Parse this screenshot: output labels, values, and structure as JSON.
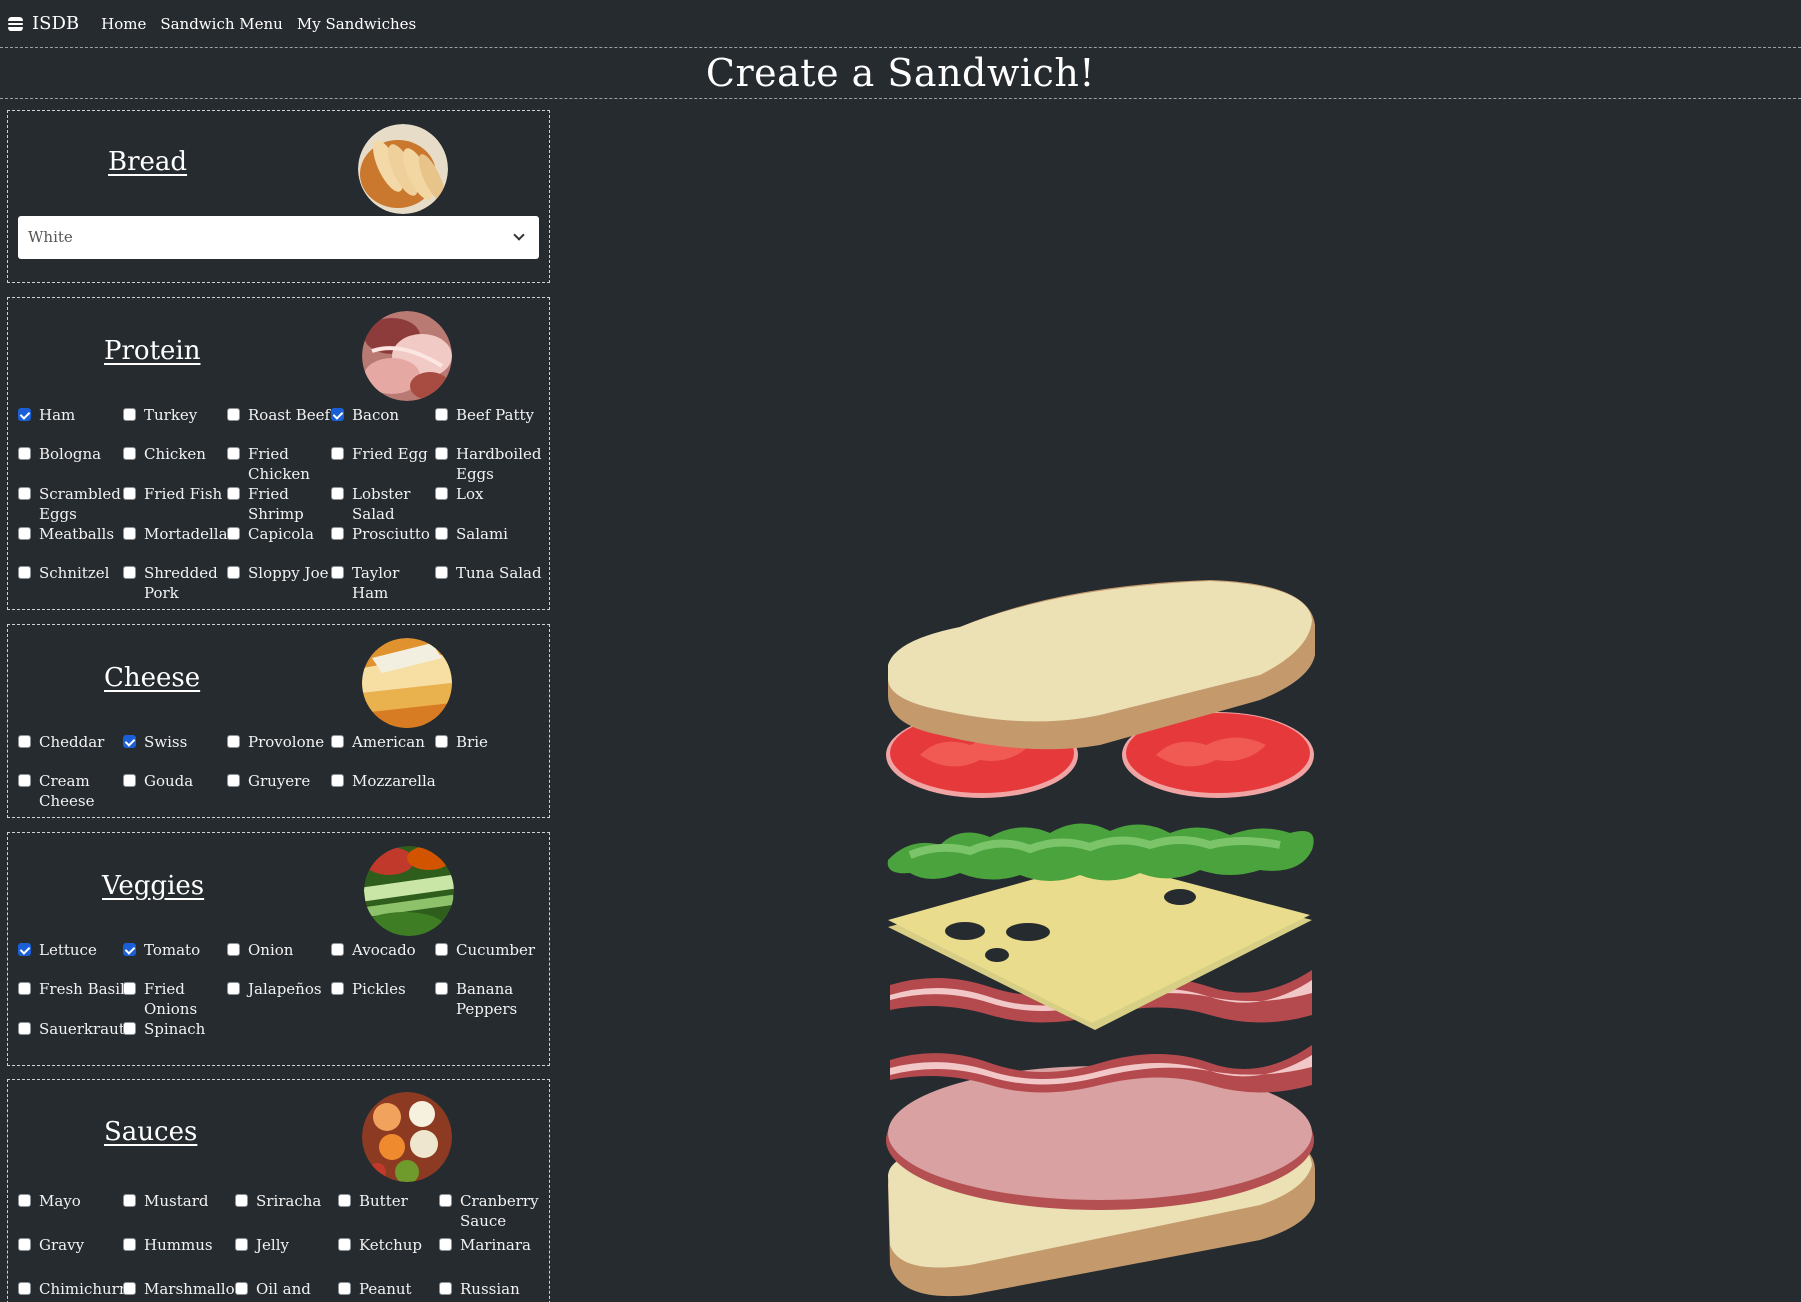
{
  "nav": {
    "brand": "ISDB",
    "brand_icon": "burger-icon",
    "links": [
      "Home",
      "Sandwich Menu",
      "My Sandwiches"
    ]
  },
  "page": {
    "title": "Create a Sandwich!"
  },
  "bread": {
    "title": "Bread",
    "photo": "bread-photo",
    "selected": "White"
  },
  "protein": {
    "title": "Protein",
    "photo": "protein-photo",
    "options": [
      {
        "label": "Ham",
        "checked": true
      },
      {
        "label": "Turkey",
        "checked": false
      },
      {
        "label": "Roast Beef",
        "checked": false
      },
      {
        "label": "Bacon",
        "checked": true
      },
      {
        "label": "Beef Patty",
        "checked": false
      },
      {
        "label": "Bologna",
        "checked": false
      },
      {
        "label": "Chicken",
        "checked": false
      },
      {
        "label": "Fried Chicken",
        "checked": false
      },
      {
        "label": "Fried Egg",
        "checked": false
      },
      {
        "label": "Hardboiled Eggs",
        "checked": false
      },
      {
        "label": "Scrambled Eggs",
        "checked": false
      },
      {
        "label": "Fried Fish",
        "checked": false
      },
      {
        "label": "Fried Shrimp",
        "checked": false
      },
      {
        "label": "Lobster Salad",
        "checked": false
      },
      {
        "label": "Lox",
        "checked": false
      },
      {
        "label": "Meatballs",
        "checked": false
      },
      {
        "label": "Mortadella",
        "checked": false
      },
      {
        "label": "Capicola",
        "checked": false
      },
      {
        "label": "Prosciutto",
        "checked": false
      },
      {
        "label": "Salami",
        "checked": false
      },
      {
        "label": "Schnitzel",
        "checked": false
      },
      {
        "label": "Shredded Pork",
        "checked": false
      },
      {
        "label": "Sloppy Joe",
        "checked": false
      },
      {
        "label": "Taylor Ham",
        "checked": false
      },
      {
        "label": "Tuna Salad",
        "checked": false
      }
    ]
  },
  "cheese": {
    "title": "Cheese",
    "photo": "cheese-photo",
    "options": [
      {
        "label": "Cheddar",
        "checked": false
      },
      {
        "label": "Swiss",
        "checked": true
      },
      {
        "label": "Provolone",
        "checked": false
      },
      {
        "label": "American",
        "checked": false
      },
      {
        "label": "Brie",
        "checked": false
      },
      {
        "label": "Cream Cheese",
        "checked": false
      },
      {
        "label": "Gouda",
        "checked": false
      },
      {
        "label": "Gruyere",
        "checked": false
      },
      {
        "label": "Mozzarella",
        "checked": false
      }
    ]
  },
  "veggies": {
    "title": "Veggies",
    "photo": "veggies-photo",
    "options": [
      {
        "label": "Lettuce",
        "checked": true
      },
      {
        "label": "Tomato",
        "checked": true
      },
      {
        "label": "Onion",
        "checked": false
      },
      {
        "label": "Avocado",
        "checked": false
      },
      {
        "label": "Cucumber",
        "checked": false
      },
      {
        "label": "Fresh Basil",
        "checked": false
      },
      {
        "label": "Fried Onions",
        "checked": false
      },
      {
        "label": "Jalapeños",
        "checked": false
      },
      {
        "label": "Pickles",
        "checked": false
      },
      {
        "label": "Banana Peppers",
        "checked": false
      },
      {
        "label": "Sauerkraut",
        "checked": false
      },
      {
        "label": "Spinach",
        "checked": false
      }
    ]
  },
  "sauces": {
    "title": "Sauces",
    "photo": "sauces-photo",
    "options": [
      {
        "label": "Mayo",
        "checked": false
      },
      {
        "label": "Mustard",
        "checked": false
      },
      {
        "label": "Sriracha",
        "checked": false
      },
      {
        "label": "Butter",
        "checked": false
      },
      {
        "label": "Cranberry Sauce",
        "checked": false
      },
      {
        "label": "Gravy",
        "checked": false
      },
      {
        "label": "Hummus",
        "checked": false
      },
      {
        "label": "Jelly",
        "checked": false
      },
      {
        "label": "Ketchup",
        "checked": false
      },
      {
        "label": "Marinara",
        "checked": false
      },
      {
        "label": "Chimichurri",
        "checked": false
      },
      {
        "label": "Marshmallow",
        "checked": false
      },
      {
        "label": "Oil and",
        "checked": false
      },
      {
        "label": "Peanut Butt",
        "checked": false
      },
      {
        "label": "Russian",
        "checked": false
      }
    ]
  },
  "preview": {
    "layers": [
      "top-bread",
      "tomato",
      "lettuce",
      "swiss-cheese",
      "bacon",
      "ham",
      "bottom-bread"
    ]
  },
  "colors": {
    "background": "#262b30",
    "checkbox_checked": "#1a5fd6",
    "bread": "#ece0b5",
    "crust": "#c49a6c",
    "tomato": "#e6393b",
    "lettuce": "#4aa33c",
    "cheese": "#e9dc8c",
    "bacon": "#b54a4e",
    "ham": "#d9a1a1"
  }
}
